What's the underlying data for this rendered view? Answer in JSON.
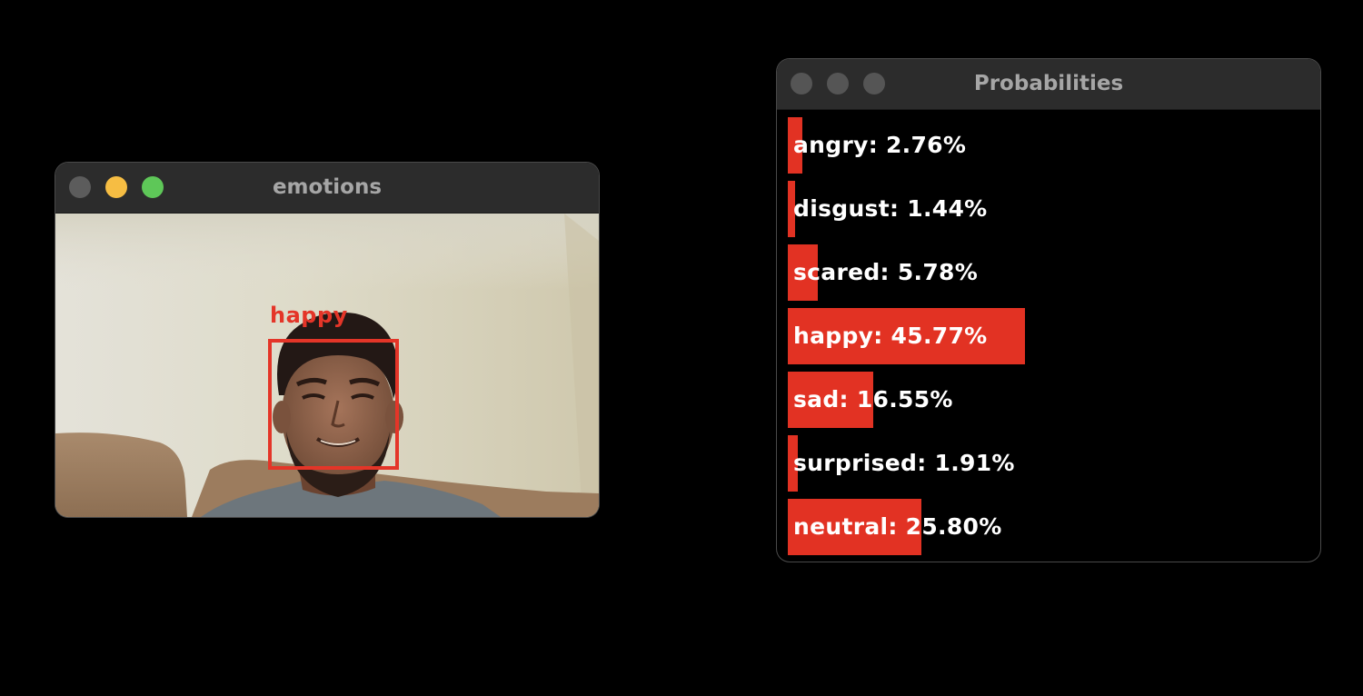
{
  "windows": {
    "emotions": {
      "title": "emotions",
      "detection_label": "happy"
    },
    "probabilities": {
      "title": "Probabilities",
      "items": [
        {
          "label": "angry",
          "text": "angry: 2.76%",
          "value": 2.76
        },
        {
          "label": "disgust",
          "text": "disgust: 1.44%",
          "value": 1.44
        },
        {
          "label": "scared",
          "text": "scared: 5.78%",
          "value": 5.78
        },
        {
          "label": "happy",
          "text": "happy: 45.77%",
          "value": 45.77
        },
        {
          "label": "sad",
          "text": "sad: 16.55%",
          "value": 16.55
        },
        {
          "label": "surprised",
          "text": "surprised: 1.91%",
          "value": 1.91
        },
        {
          "label": "neutral",
          "text": "neutral: 25.80%",
          "value": 25.8
        }
      ]
    }
  },
  "colors": {
    "bar": "#e23223",
    "detection_box": "#e43528",
    "titlebar": "#2c2c2c"
  }
}
